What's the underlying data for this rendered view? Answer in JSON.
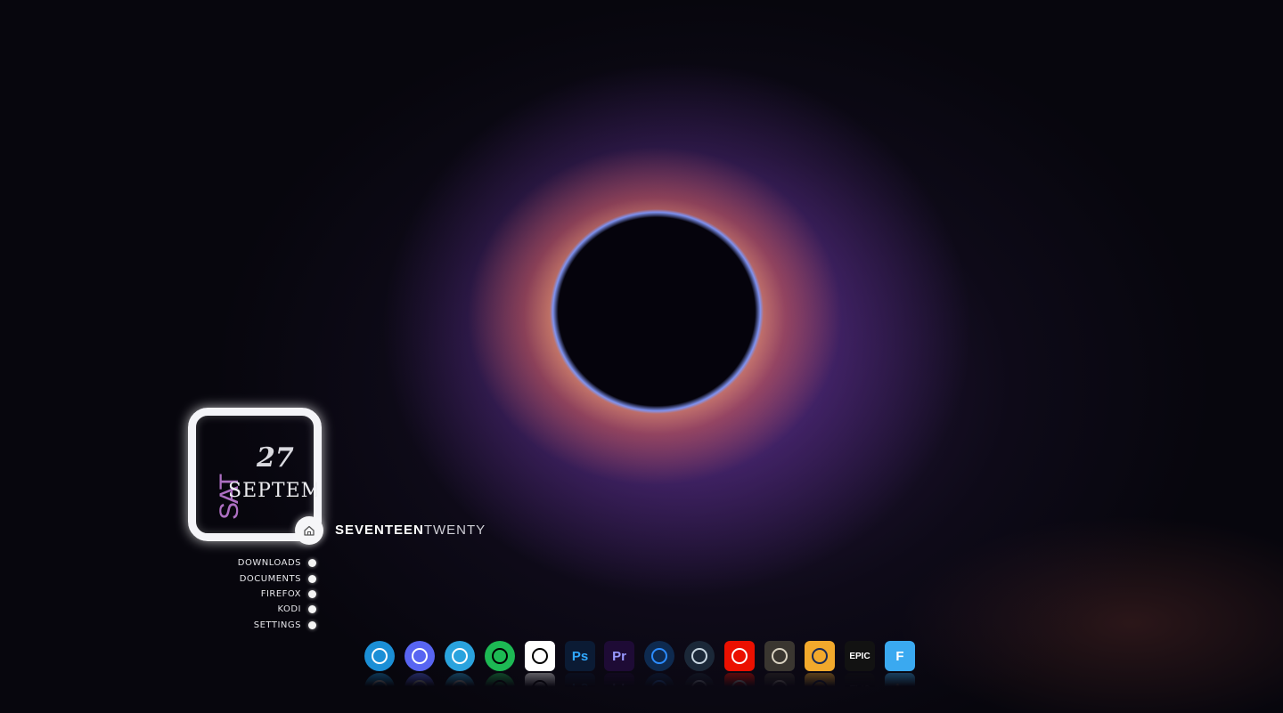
{
  "date_widget": {
    "day_abbr": "SAT",
    "day_number": "27",
    "month": "SEPTEMBER"
  },
  "time_display": {
    "hour_text": "SEVENTEEN",
    "minute_text": "TWENTY"
  },
  "shortcuts": [
    {
      "label": "DOWNLOADS"
    },
    {
      "label": "DOCUMENTS"
    },
    {
      "label": "FIREFOX"
    },
    {
      "label": "KODI"
    },
    {
      "label": "SETTINGS"
    }
  ],
  "dock": {
    "apps": [
      {
        "name": "Edge",
        "icon": "edge-icon",
        "glyph": "",
        "bg": "#1b8fd6",
        "fg": "#ffffff"
      },
      {
        "name": "Discord",
        "icon": "discord-icon",
        "glyph": "",
        "bg": "#5865f2",
        "fg": "#ffffff"
      },
      {
        "name": "Telegram",
        "icon": "telegram-icon",
        "glyph": "",
        "bg": "#2aa3de",
        "fg": "#ffffff"
      },
      {
        "name": "Spotify",
        "icon": "spotify-icon",
        "glyph": "",
        "bg": "#1db954",
        "fg": "#000000"
      },
      {
        "name": "CapCut",
        "icon": "capcut-icon",
        "glyph": "",
        "bg": "#ffffff",
        "fg": "#000000"
      },
      {
        "name": "Photoshop",
        "icon": "photoshop-icon",
        "glyph": "Ps",
        "bg": "#0b1b34",
        "fg": "#31a8ff"
      },
      {
        "name": "Premiere Pro",
        "icon": "premiere-icon",
        "glyph": "Pr",
        "bg": "#1e0b35",
        "fg": "#9999ff"
      },
      {
        "name": "TeamViewer",
        "icon": "teamviewer-icon",
        "glyph": "",
        "bg": "#0e2a4f",
        "fg": "#2c8cff"
      },
      {
        "name": "Steam",
        "icon": "steam-icon",
        "glyph": "",
        "bg": "#1b2838",
        "fg": "#c7d5e0"
      },
      {
        "name": "Adobe",
        "icon": "adobe-icon",
        "glyph": "",
        "bg": "#eb1000",
        "fg": "#ffffff"
      },
      {
        "name": "PUBG",
        "icon": "pubg-icon",
        "glyph": "",
        "bg": "#3a3630",
        "fg": "#d9d2c1"
      },
      {
        "name": "Counter-Strike",
        "icon": "counter-strike-icon",
        "glyph": "",
        "bg": "#f2a92c",
        "fg": "#1a2a55"
      },
      {
        "name": "Epic Games",
        "icon": "epic-games-icon",
        "glyph": "EPIC",
        "bg": "#121212",
        "fg": "#ffffff"
      },
      {
        "name": "Files",
        "icon": "files-icon",
        "glyph": "F",
        "bg": "#3aa9f0",
        "fg": "#ffffff"
      }
    ]
  }
}
